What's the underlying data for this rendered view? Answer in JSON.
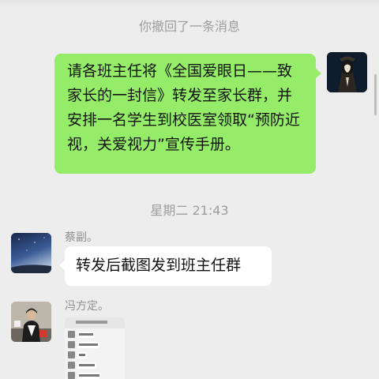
{
  "system": {
    "recall_notice": "你撤回了一条消息",
    "timestamp": "星期二 21:43"
  },
  "messages": [
    {
      "sender": "self",
      "text": "请各班主任将《全国爱眼日——致家长的一封信》转发至家长群，并安排一名学生到校医室领取“预防近视，关爱视力”宣传手册。",
      "bubble_color": "#95ec69"
    },
    {
      "sender": "蔡副。",
      "text": "转发后截图发到班主任群",
      "bubble_color": "#ffffff"
    },
    {
      "sender": "冯方定。",
      "type": "image",
      "content": "screenshot-thumbnail"
    }
  ],
  "colors": {
    "background": "#ededed",
    "self_bubble": "#95ec69",
    "other_bubble": "#ffffff",
    "system_text": "#9d9d9d"
  },
  "icons": {
    "self_avatar": "silhouette-avatar",
    "cai_avatar": "night-sky-avatar",
    "feng_avatar": "person-photo-avatar"
  }
}
